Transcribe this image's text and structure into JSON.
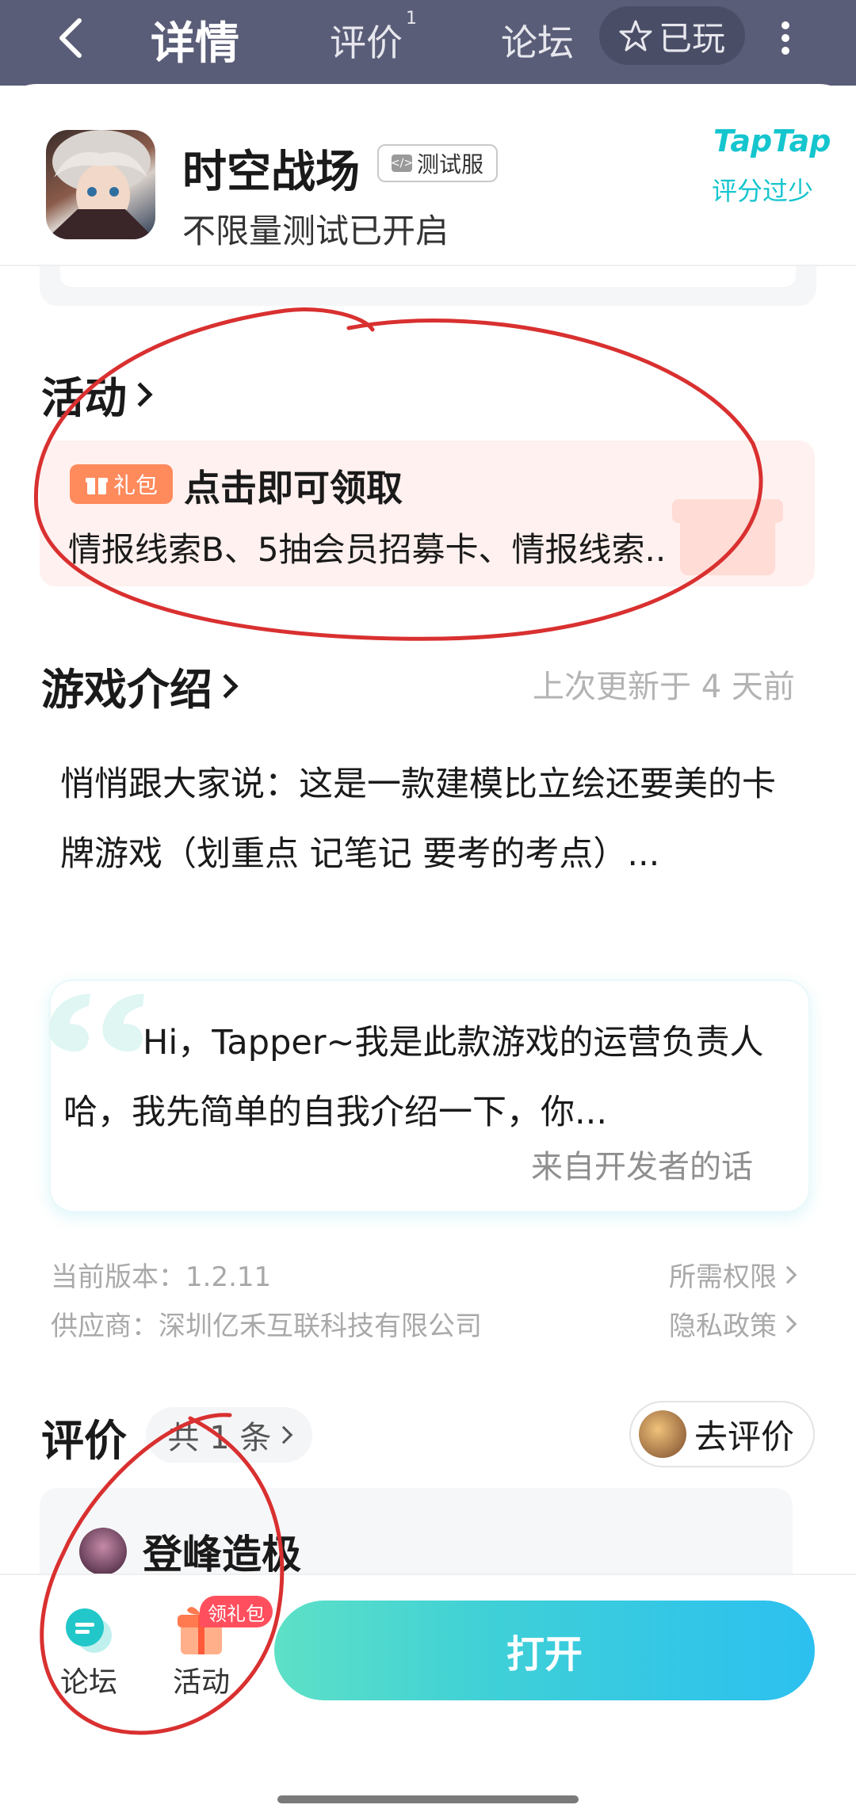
{
  "topbar": {
    "title": "详情",
    "tabs": [
      {
        "label": "评价",
        "badge": "1"
      },
      {
        "label": "论坛"
      }
    ],
    "played_label": "已玩"
  },
  "app": {
    "name": "时空战场",
    "test_badge": "测试服",
    "subtitle": "不限量测试已开启",
    "brand": "TapTap",
    "rating_note": "评分过少"
  },
  "activity": {
    "section_title": "活动",
    "badge_label": "礼包",
    "title": "点击即可领取",
    "description": "情报线索B、5抽会员招募卡、情报线索.."
  },
  "intro": {
    "section_title": "游戏介绍",
    "updated": "上次更新于 4 天前",
    "text": "悄悄跟大家说：这是一款建模比立绘还要美的卡牌游戏（划重点 记笔记 要考的考点）..."
  },
  "developer": {
    "text": "Hi，Tapper~我是此款游戏的运营负责人哈，我先简单的自我介绍一下，你...",
    "from": "来自开发者的话"
  },
  "meta": {
    "version": "当前版本：1.2.11",
    "vendor": "供应商：深圳亿禾互联科技有限公司",
    "permissions": "所需权限",
    "privacy": "隐私政策"
  },
  "reviews": {
    "section_title": "评价",
    "count_label": "共 1 条",
    "go_review": "去评价",
    "first_reviewer": "登峰造极"
  },
  "bottom": {
    "forum_label": "论坛",
    "activity_label": "活动",
    "gift_tag": "领礼包",
    "open_button": "打开"
  },
  "colors": {
    "topbar": "#5a5d77",
    "accent": "#15c5ce",
    "gift": "#ff8a5c",
    "annotation": "#d93030"
  }
}
